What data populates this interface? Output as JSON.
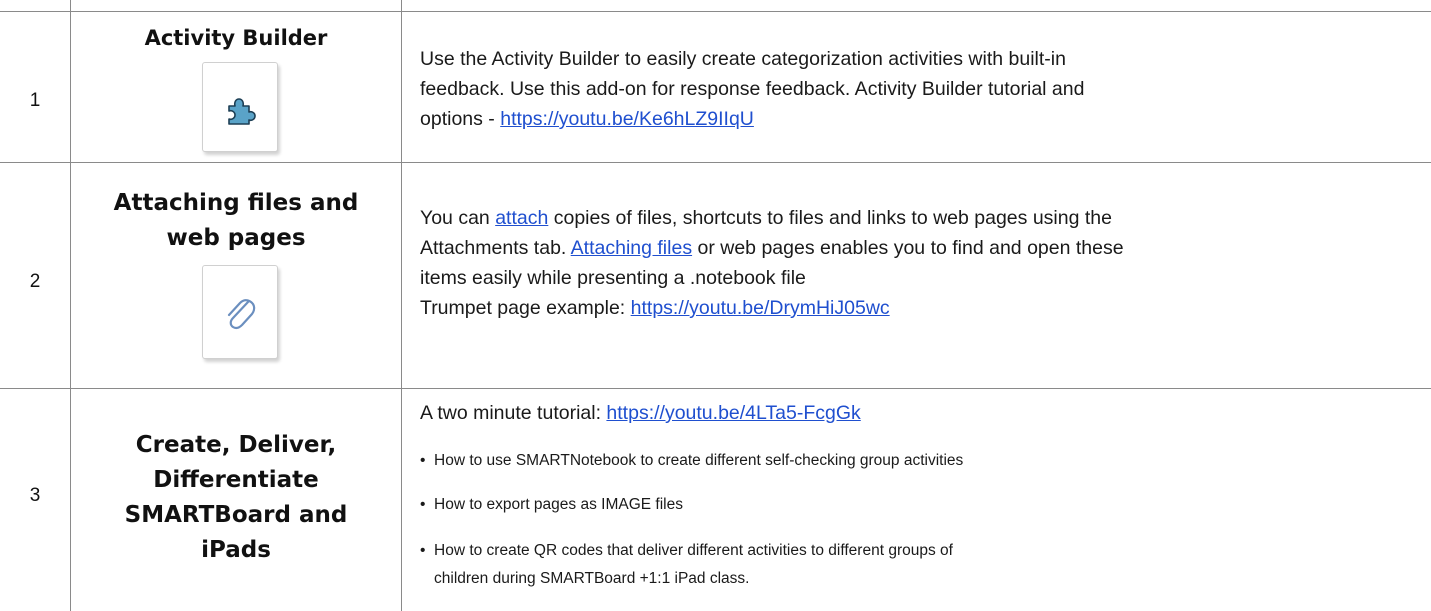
{
  "rows": [
    {
      "number": "1",
      "title": "Activity Builder",
      "icon": "puzzle-piece-icon",
      "description": {
        "line1": "Use the Activity Builder to easily create categorization activities with built-in",
        "line2": "feedback.  Use this add-on for response feedback. Activity Builder tutorial and",
        "line3_prefix": "options - ",
        "link": "https://youtu.be/Ke6hLZ9IIqU"
      }
    },
    {
      "number": "2",
      "title_line1": "Attaching files and",
      "title_line2": "web pages",
      "icon": "paperclip-icon",
      "description": {
        "line1_prefix": "You can ",
        "line1_link": "attach",
        "line1_suffix": " copies of files, shortcuts to files and links to web pages using the",
        "line2_prefix": "Attachments tab. ",
        "line2_link": "Attaching files",
        "line2_suffix": " or web pages enables you to find and open these",
        "line3": "items easily while presenting a .notebook file",
        "line4_prefix": "Trumpet page example: ",
        "line4_link": "https://youtu.be/DrymHiJ05wc"
      }
    },
    {
      "number": "3",
      "title_line1": "Create, Deliver,",
      "title_line2": "Differentiate",
      "title_line3": "SMARTBoard and",
      "title_line4": "iPads",
      "description": {
        "intro_prefix": "A two minute tutorial: ",
        "intro_link": "https://youtu.be/4LTa5-FcgGk",
        "bullet1": "How to use SMARTNotebook to create different self-checking group activities",
        "bullet2": "How to export pages as IMAGE files",
        "bullet3_line1": "How to create QR codes that deliver different activities to different groups of",
        "bullet3_line2": "children during SMARTBoard +1:1 iPad class."
      }
    }
  ],
  "colors": {
    "border": "#8a8a8a",
    "link": "#1f4fcf",
    "puzzle_fill": "#5aa3c8",
    "paperclip_stroke": "#6b8fbf"
  }
}
